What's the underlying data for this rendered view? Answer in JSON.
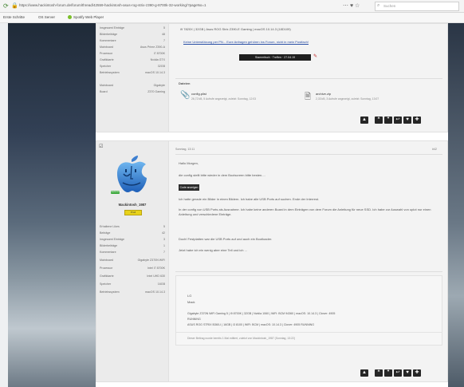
{
  "browser": {
    "url": "https://www.hackintosh-forum.de/forum/thread/42559-hackintosh-asus-rog-strix-z390-g-8700k-32-working/?pageNo=1",
    "search_placeholder": "Suchen",
    "bookmarks": [
      "Erste Schritte",
      "OS Server",
      "Spotify Web Player"
    ]
  },
  "post1": {
    "user_fields": [
      {
        "k": "Insgesamt Einträge",
        "v": "5"
      },
      {
        "k": "Bilderbeiträge",
        "v": "48"
      },
      {
        "k": "Kommentare",
        "v": "7"
      },
      {
        "k": "Mainboard",
        "v": "Asus Prime Z390-A"
      },
      {
        "k": "Prozessor",
        "v": "i7 8700K"
      },
      {
        "k": "Grafikkarte",
        "v": "Nvidia GTX"
      },
      {
        "k": "Speicher",
        "v": "32GB"
      },
      {
        "k": "Betriebssystem",
        "v": "macOS 10.14.3"
      },
      {
        "k": "Mainboard",
        "v": "Gigabyte"
      },
      {
        "k": "Board",
        "v": "Z370 Gaming"
      }
    ],
    "hw_line": "i9 7820X | 32GB | Asus ROG Strix Z390-E Gaming | macOS 10.14.3 (18D109)",
    "link": "Keine Unterstützung per PN... Eure Anfragen gehören ins Forum, nicht in mein Postfach!",
    "banner": "Stammtisch · Treffen · 27.04.19",
    "attachments_title": "Dateien",
    "attachments": [
      {
        "icon": "paperclip-icon",
        "name": "config.plist",
        "meta": "26,72 kB, 5 Aufrufe angezeigt, zuletzt: Sonntag, 12:03"
      },
      {
        "icon": "zip-file-icon",
        "name": "archive.zip",
        "meta": "2,33 kB, 3 Aufrufe angezeigt, zuletzt: Sonntag, 13:07"
      }
    ]
  },
  "post2": {
    "timestamp": "Sonntag, 13:11",
    "post_no": "#42",
    "username": "Mackintosh_1987",
    "rank_badge": "Hackintosh",
    "status_badge": "Profi",
    "user_fields": [
      {
        "k": "Erhaltene Likes",
        "v": "5"
      },
      {
        "k": "Beiträge",
        "v": "42"
      },
      {
        "k": "Insgesamt Einträge",
        "v": "3"
      },
      {
        "k": "Bilderbeiträge",
        "v": "1"
      },
      {
        "k": "Kommentare",
        "v": "7"
      },
      {
        "k": "Mainboard",
        "v": "Gigabyte Z370N WiFi"
      },
      {
        "k": "Prozessor",
        "v": "Intel i7 8700K"
      },
      {
        "k": "Grafikkarte",
        "v": "Intel UHD 630"
      },
      {
        "k": "Speicher",
        "v": "16GB"
      },
      {
        "k": "Betriebssystem",
        "v": "macOS 10.14.3"
      }
    ],
    "greeting": "Hallo Morgen,",
    "paragraphs": [
      "die config stellt bitte wieder in dem Bootscreen bitte besten....",
      "Ich hatte gerade ein Bilder in einen Bildern. Ich habe alle USB Ports auf suchen. Ende der Interrest.",
      "In der config von USB Ports als Ausnahme. Ich habe keine anderen Board in dem Einträgen von dem Forum die Anleitung für neue SSD. Ich habe zur Auswahl von uplot nur einen Anleitung und verschiedene Einträge.",
      "Doch! Festplatten war die USB Ports auf und auch ein Bootloader.",
      "Jetzt habe ich ein wenig aber eine Teil und ich ..."
    ],
    "quote_button": "Code anzeigen",
    "signature_lines": [
      "LG",
      "Mack",
      "Gigabyte Z370N WiFi Gaming 5 | i9 8700K | 32GB | Nvidia 1060 | WiFi: BCM 94360 | macOS: 10.14.3 | Clover: 4905",
      "RUNNING",
      "ASUS ROG STRIX B360-I | 16GB | i3 8100 | WiFi: BCM | macOS: 10.14.3 | Clover: 4905 RUNNING"
    ],
    "edit_note": "Dieser Beitrag wurde bereits 1 Mal editiert, zuletzt von Mackintosh_1987 (Sonntag, 13:22)"
  },
  "action_icons": [
    "warning-icon",
    "quote-icon",
    "multiquote-icon",
    "reply-icon",
    "like-icon",
    "share-icon"
  ]
}
